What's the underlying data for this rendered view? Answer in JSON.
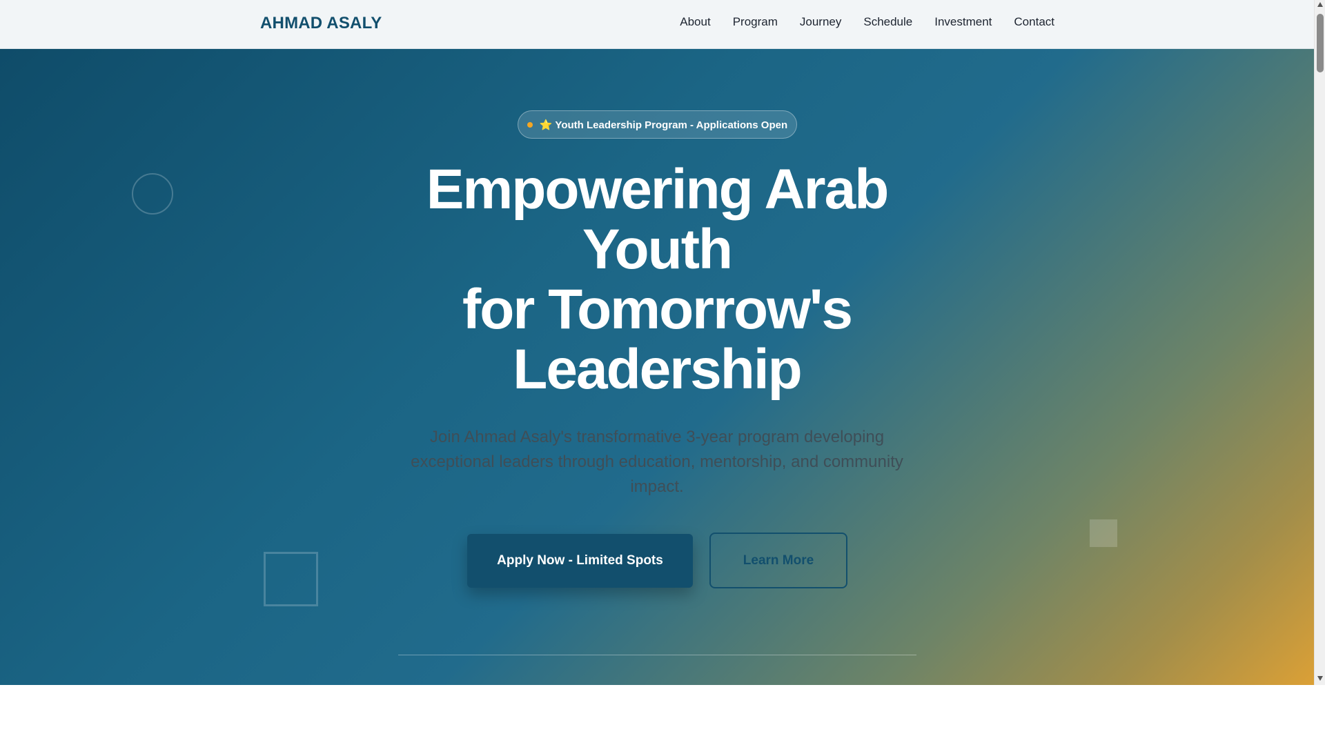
{
  "nav": {
    "logo": "AHMAD ASALY",
    "links": [
      "About",
      "Program",
      "Journey",
      "Schedule",
      "Investment",
      "Contact"
    ]
  },
  "hero": {
    "badge": "⭐ Youth Leadership Program - Applications Open",
    "title_lines": [
      "Empowering Arab",
      "Youth",
      "for Tomorrow's",
      "Leadership"
    ],
    "subtitle": "Join Ahmad Asaly's transformative 3-year program developing exceptional leaders through education, mentorship, and community impact.",
    "primary_button": "Apply Now - Limited Spots",
    "secondary_button": "Learn More"
  },
  "colors": {
    "brand": "#124f6d",
    "accent": "#f5a623",
    "gradient_start": "#0f4c69",
    "gradient_end": "#dba036"
  }
}
